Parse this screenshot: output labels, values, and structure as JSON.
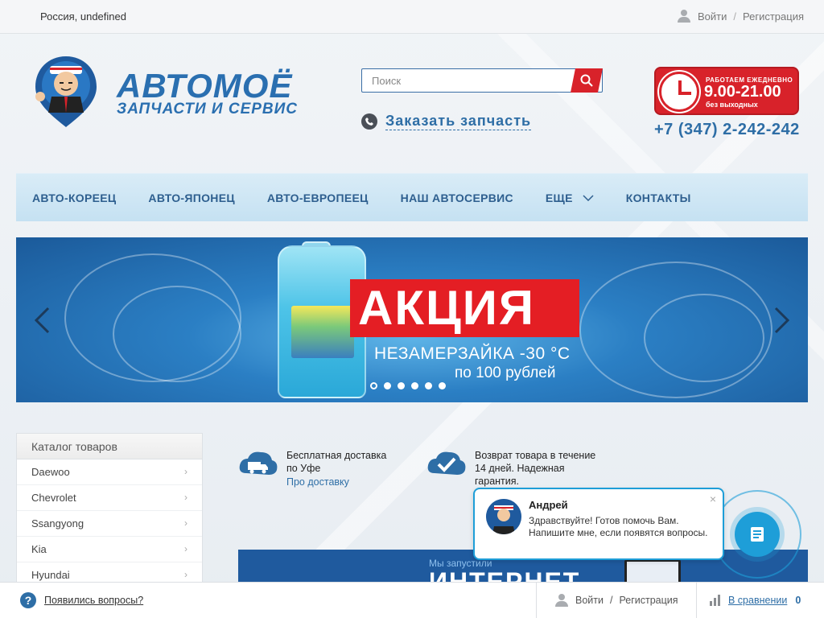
{
  "topbar": {
    "region": "Россия, undefined",
    "login": "Войти",
    "separator": "/",
    "register": "Регистрация"
  },
  "header": {
    "logo_title": "АВТОМОЁ",
    "logo_subtitle": "ЗАПЧАСТИ И СЕРВИС",
    "search_placeholder": "Поиск",
    "order_part": "Заказать запчасть",
    "hours_top": "РАБОТАЕМ ЕЖЕДНЕВНО",
    "hours_main": "9.00-21.00",
    "hours_bottom": "без выходных",
    "phone": "+7 (347) 2-242-242"
  },
  "nav": {
    "items": [
      {
        "label": "АВТО-КОРЕЕЦ"
      },
      {
        "label": "АВТО-ЯПОНЕЦ"
      },
      {
        "label": "АВТО-ЕВРОПЕЕЦ"
      },
      {
        "label": "НАШ АВТОСЕРВИС"
      },
      {
        "label": "ЕЩЕ"
      },
      {
        "label": "КОНТАКТЫ"
      }
    ]
  },
  "banner": {
    "title": "АКЦИЯ",
    "line1": "НЕЗАМЕРЗАЙКА -30 °С",
    "line2": "по 100 рублей",
    "slide_count": 6,
    "active_slide": 1
  },
  "catalog": {
    "header": "Каталог товаров",
    "items": [
      {
        "label": "Daewoo"
      },
      {
        "label": "Chevrolet"
      },
      {
        "label": "Ssangyong"
      },
      {
        "label": "Kia"
      },
      {
        "label": "Hyundai"
      }
    ]
  },
  "features": [
    {
      "text_line1": "Бесплатная доставка",
      "text_line2": "по Уфе",
      "link": "Про доставку"
    },
    {
      "text_line1": "Возврат товара в течение",
      "text_line2": "14 дней. Надежная",
      "text_line3": "гарантия."
    }
  ],
  "internet_banner": {
    "small": "Мы запустили",
    "big": "ИНТЕРНЕТ"
  },
  "chat": {
    "name": "Андрей",
    "message": "Здравствуйте! Готов помочь Вам. Напишите мне, если появятся вопросы.",
    "close": "×"
  },
  "bottombar": {
    "help": "Появились вопросы?",
    "login": "Войти",
    "separator": "/",
    "register": "Регистрация",
    "compare": "В сравнении",
    "compare_count": "0"
  },
  "colors": {
    "brand_blue": "#2e6ea6",
    "accent_red": "#d8222a",
    "chat_blue": "#1e9ed8"
  }
}
